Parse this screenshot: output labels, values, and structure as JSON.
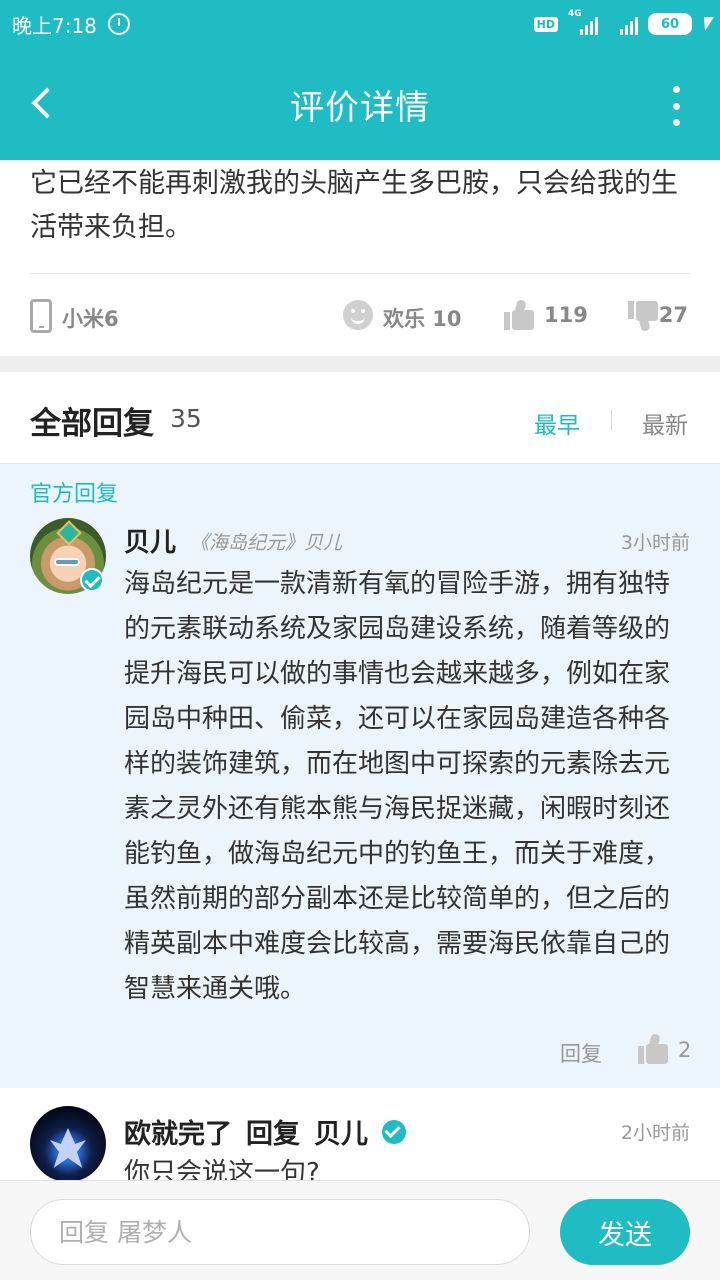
{
  "status_bar": {
    "time": "晚上7:18",
    "hd_label": "HD",
    "network_label": "4G",
    "battery_level": "60"
  },
  "toolbar": {
    "title": "评价详情"
  },
  "review": {
    "text": "它已经不能再刺激我的头脑产生多巴胺，只会给我的生活带来负担。",
    "device": "小米6",
    "mood": "欢乐 10",
    "likes": "119",
    "dislikes": "27"
  },
  "replies": {
    "label": "全部回复",
    "count": "35",
    "sort_earliest": "最早",
    "sort_newest": "最新"
  },
  "official_reply": {
    "tag": "官方回复",
    "name": "贝儿",
    "game_tag": "《海岛纪元》贝儿",
    "time": "3小时前",
    "content": "海岛纪元是一款清新有氧的冒险手游，拥有独特的元素联动系统及家园岛建设系统，随着等级的提升海民可以做的事情也会越来越多，例如在家园岛中种田、偷菜，还可以在家园岛建造各种各样的装饰建筑，而在地图中可探索的元素除去元素之灵外还有熊本熊与海民捉迷藏，闲暇时刻还能钓鱼，做海岛纪元中的钓鱼王，而关于难度，虽然前期的部分副本还是比较简单的，但之后的精英副本中难度会比较高，需要海民依靠自己的智慧来通关哦。",
    "reply_label": "回复",
    "like_count": "2"
  },
  "nested_reply": {
    "author": "欧就完了",
    "action": "回复",
    "target": "贝儿",
    "time": "2小时前",
    "content": "你只会说这一句?"
  },
  "input_bar": {
    "placeholder": "回复 屠梦人",
    "send_label": "发送"
  },
  "colors": {
    "accent": "#1fbcc4",
    "official_bg": "#ebf5fb"
  }
}
